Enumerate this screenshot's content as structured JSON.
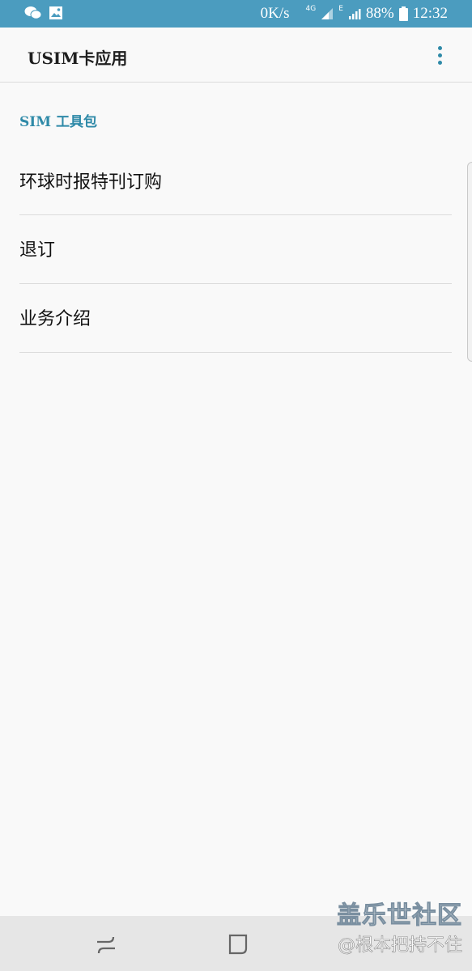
{
  "status_bar": {
    "network_speed": "0K/s",
    "network_type_1": "4G",
    "network_type_2": "E",
    "battery": "88%",
    "time": "12:32",
    "icons": [
      "wechat-icon",
      "image-icon",
      "signal-icon",
      "battery-icon"
    ]
  },
  "app_bar": {
    "title": "USIM卡应用",
    "menu_icon": "more-vert-icon"
  },
  "section": {
    "header": "SIM 工具包"
  },
  "list": {
    "items": [
      {
        "label": "环球时报特刊订购"
      },
      {
        "label": "退订"
      },
      {
        "label": "业务介绍"
      }
    ]
  },
  "watermark": {
    "line1": "盖乐世社区",
    "line2": "@根本把持不住"
  },
  "nav_bar": {
    "icons": [
      "recent-apps-icon",
      "home-icon"
    ]
  },
  "colors": {
    "status_bar": "#4b9cbf",
    "accent": "#2f8aa8",
    "background": "#f9f9f9",
    "divider": "#dcdcdc"
  }
}
